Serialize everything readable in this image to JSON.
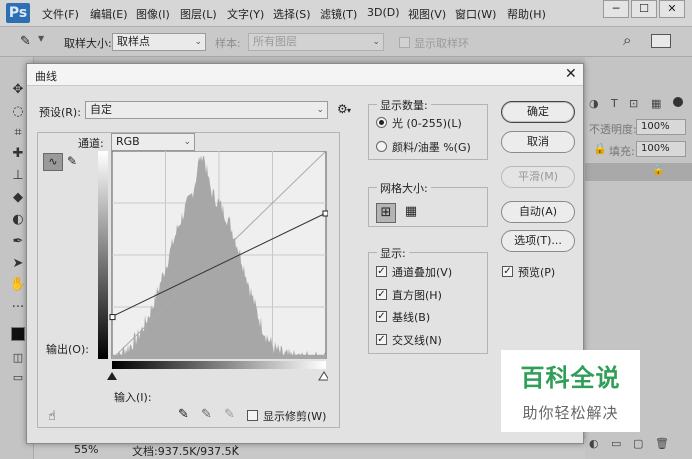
{
  "app": {
    "logo": "Ps"
  },
  "menubar": {
    "items": [
      "文件(F)",
      "编辑(E)",
      "图像(I)",
      "图层(L)",
      "文字(Y)",
      "选择(S)",
      "滤镜(T)",
      "3D(D)",
      "视图(V)",
      "窗口(W)",
      "帮助(H)"
    ],
    "window_buttons": [
      "─",
      "☐",
      "✕"
    ]
  },
  "options_bar": {
    "sample_size_label": "取样大小:",
    "sample_size_value": "取样点",
    "sample_label": "样本:",
    "sample_value": "所有图层",
    "show_ring_label": "显示取样环"
  },
  "right_panel": {
    "opacity_label": "不透明度:",
    "opacity_value": "100%",
    "fill_label": "填充:",
    "fill_value": "100%"
  },
  "status_bar": {
    "zoom": "55%",
    "doc_info": "文档:937.5K/937.5K"
  },
  "curves_dialog": {
    "title": "曲线",
    "preset_label": "预设(R):",
    "preset_value": "自定",
    "channel_label": "通道:",
    "channel_value": "RGB",
    "output_label": "输出(O):",
    "input_label": "输入(I):",
    "show_clipping_label": "显示修剪(W)",
    "display_amount": {
      "title": "显示数量:",
      "light_label": "光 (0-255)(L)",
      "pigment_label": "颜料/油墨 %(G)",
      "selected": "light"
    },
    "grid_size": {
      "title": "网格大小:"
    },
    "show": {
      "title": "显示:",
      "options": [
        {
          "label": "通道叠加(V)",
          "checked": true
        },
        {
          "label": "直方图(H)",
          "checked": true
        },
        {
          "label": "基线(B)",
          "checked": true
        },
        {
          "label": "交叉线(N)",
          "checked": true
        }
      ]
    },
    "buttons": {
      "ok": "确定",
      "cancel": "取消",
      "smooth": "平滑(M)",
      "auto": "自动(A)",
      "options": "选项(T)..."
    },
    "preview_label": "预览(P)",
    "preview_checked": true,
    "curve_points": [
      {
        "input": 0,
        "output": 52
      },
      {
        "input": 255,
        "output": 179
      }
    ]
  },
  "watermark": {
    "line1": "百科全说",
    "line2": "助你轻松解决"
  },
  "colors": {
    "accent": "#2c6fb3",
    "watermark_green": "#2f9e57",
    "histogram": "#a7a7a7"
  }
}
